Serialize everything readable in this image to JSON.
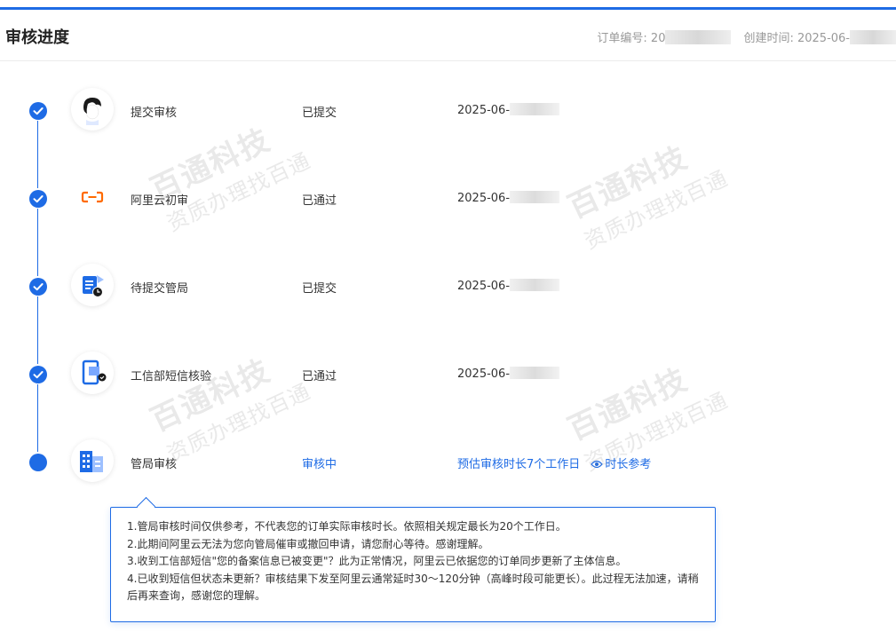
{
  "header": {
    "title": "审核进度",
    "order_label": "订单编号: 20",
    "created_label": "创建时间: 2025-06-"
  },
  "steps": [
    {
      "name": "提交审核",
      "status": "已提交",
      "time": "2025-06-",
      "icon": "person-icon",
      "state": "done"
    },
    {
      "name": "阿里云初审",
      "status": "已通过",
      "time": "2025-06-",
      "icon": "aliyun-logo-icon",
      "state": "done"
    },
    {
      "name": "待提交管局",
      "status": "已提交",
      "time": "2025-06-",
      "icon": "document-clock-icon",
      "state": "done"
    },
    {
      "name": "工信部短信核验",
      "status": "已通过",
      "time": "2025-06-",
      "icon": "phone-check-icon",
      "state": "done"
    },
    {
      "name": "管局审核",
      "status": "审核中",
      "time": "预估审核时长7个工作日",
      "link": "时长参考",
      "icon": "building-icon",
      "state": "active"
    }
  ],
  "notes": [
    "1.管局审核时间仅供参考，不代表您的订单实际审核时长。依照相关规定最长为20个工作日。",
    "2.此期间阿里云无法为您向管局催审或撤回申请，请您耐心等待。感谢理解。",
    "3.收到工信部短信\"您的备案信息已被变更\"？此为正常情况，阿里云已依据您的订单同步更新了主体信息。",
    "4.已收到短信但状态未更新？审核结果下发至阿里云通常延时30～120分钟（高峰时段可能更长）。此过程无法加速，请稍后再来查询，感谢您的理解。"
  ],
  "watermark": {
    "line1": "百通科技",
    "line2": "资质办理找百通"
  },
  "colors": {
    "accent": "#1e6be5",
    "aliyun_orange": "#ff6a00"
  }
}
